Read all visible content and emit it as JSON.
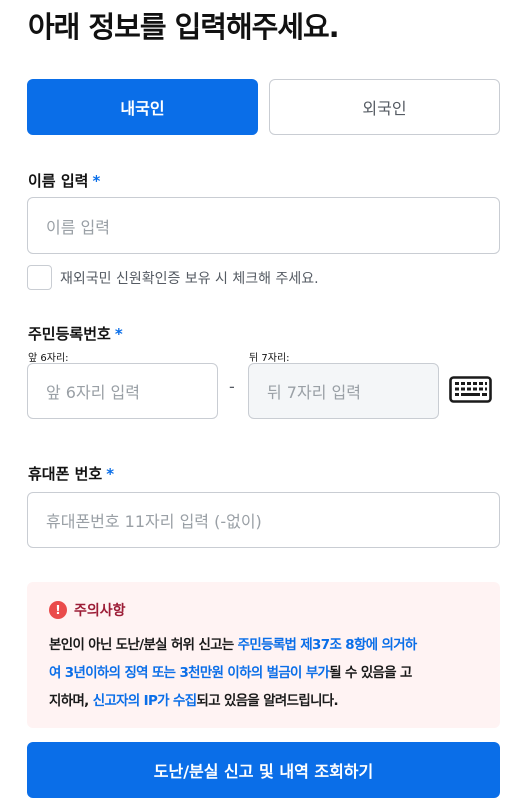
{
  "header": {
    "title": "아래 정보를 입력해주세요."
  },
  "type_toggle": {
    "domestic": "내국인",
    "foreign": "외국인"
  },
  "name": {
    "label": "이름 입력",
    "required_mark": "*",
    "placeholder": "이름 입력",
    "checkbox_label": "재외국민 신원확인증 보유 시 체크해 주세요."
  },
  "rrn": {
    "label": "주민등록번호",
    "required_mark": "*",
    "front_label": "앞 6자리:",
    "front_placeholder": "앞 6자리 입력",
    "separator": "-",
    "back_label": "뒤 7자리:",
    "back_placeholder": "뒤 7자리 입력",
    "keyboard_icon": "keyboard-icon"
  },
  "phone": {
    "label": "휴대폰 번호",
    "required_mark": "*",
    "placeholder": "휴대폰번호 11자리 입력 (-없이)"
  },
  "notice": {
    "icon": "!",
    "title": "주의사항",
    "line1": {
      "a": "본인이 아닌 도난/분실 허위 신고는 ",
      "b": "주민등록법 제37조 8항에 의거하"
    },
    "line2": {
      "a": "여 3년이하의 징역 또는 3천만원 이하의 벌금이 부가",
      "b": "될 수 있음을 고"
    },
    "line3": {
      "a": "지하며, ",
      "b": "신고자의 IP가 수집",
      "c": "되고 있음을 알려드립니다."
    }
  },
  "submit": {
    "label": "도난/분실 신고 및 내역 조회하기"
  },
  "colors": {
    "accent": "#0a6ee8",
    "notice_bg": "#fff3f3",
    "alert": "#ea4b4b"
  }
}
